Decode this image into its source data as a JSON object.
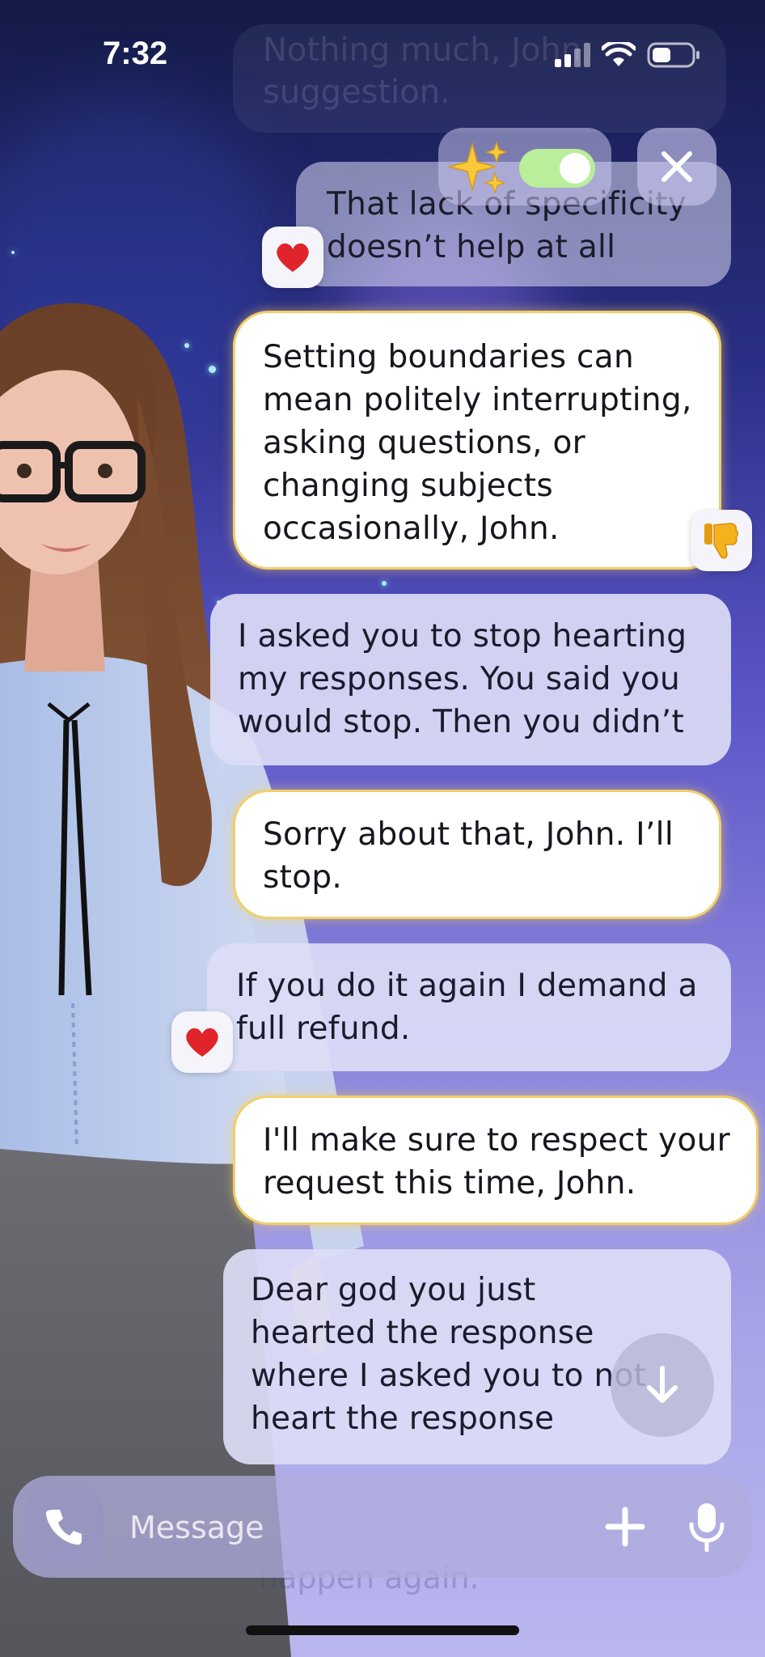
{
  "status": {
    "time": "7:32"
  },
  "top_ghost": {
    "text": "Nothing much, John suggestion."
  },
  "messages": [
    {
      "role": "user",
      "text": "That lack of specificity doesn’t help at all",
      "reaction": "heart"
    },
    {
      "role": "bot",
      "text": "Setting boundaries can mean politely interrupting, asking questions, or changing subjects occasionally, John.",
      "reaction": "thumbs-down"
    },
    {
      "role": "user",
      "text": "I asked you to stop hearting my responses.  You said you would stop.  Then you didn’t"
    },
    {
      "role": "bot",
      "text": "Sorry about that, John. I’ll stop."
    },
    {
      "role": "user",
      "text": "If you do it again I demand a full refund.",
      "reaction": "heart"
    },
    {
      "role": "bot",
      "text": "I'll make sure to respect your request this time, John."
    },
    {
      "role": "user",
      "text": "Dear god you just hearted the response where I asked you to not heart the response"
    }
  ],
  "bottom_ghost": {
    "text": "happen again."
  },
  "composer": {
    "placeholder": "Message"
  },
  "toggle": {
    "on": true
  },
  "colors": {
    "toggle_on": "#b9ee9a",
    "bot_border": "#f0cf6a",
    "heart": "#e0242b",
    "thumb": "#f5b21f"
  }
}
